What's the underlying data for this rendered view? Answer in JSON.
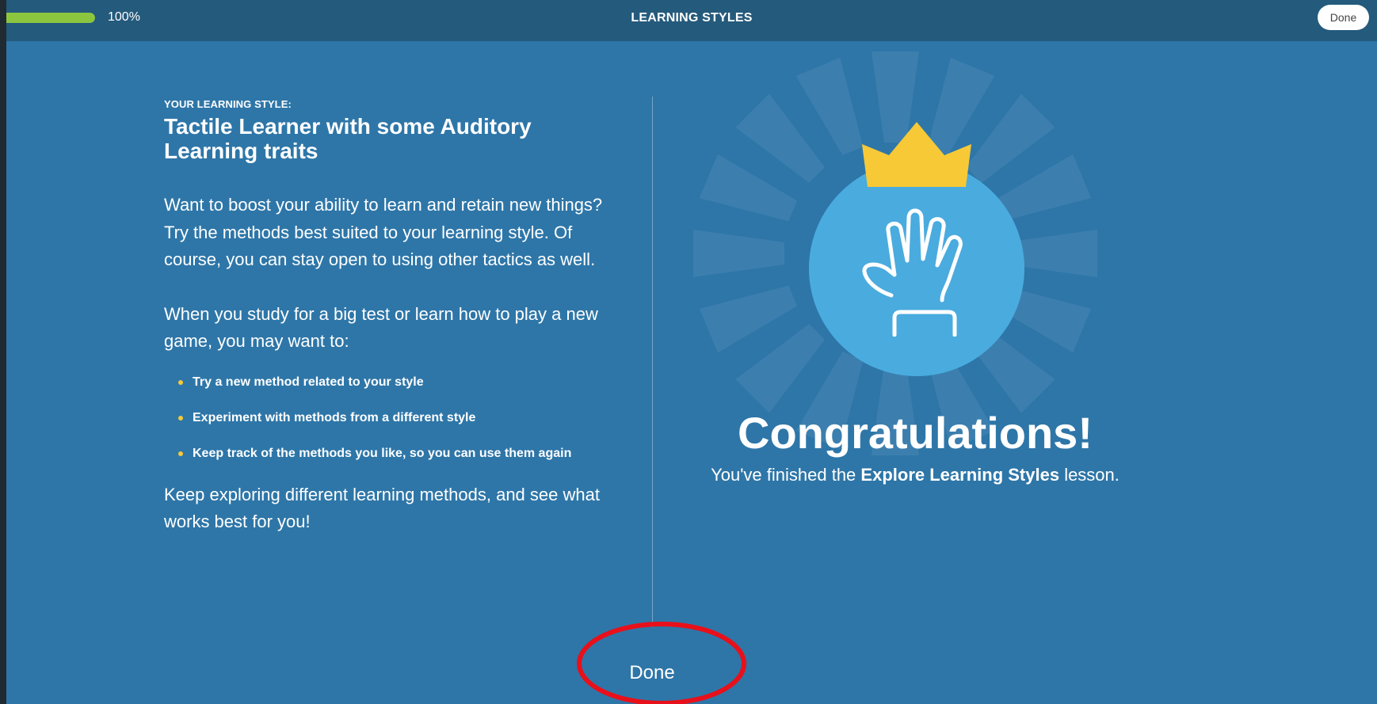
{
  "header": {
    "progress_percent": 100,
    "progress_label": "100%",
    "title": "LEARNING STYLES",
    "done_label": "Done"
  },
  "content": {
    "eyebrow": "YOUR LEARNING STYLE:",
    "headline_line1": "Tactile Learner with some Auditory",
    "headline_line2": "Learning traits",
    "paragraph1": "Want to boost your ability to learn and retain new things? Try the methods best suited to your learning style. Of course, you can stay open to using other tactics as well.",
    "paragraph2": "When you study for a big test or learn how to play a new game, you may want to:",
    "bullets": [
      "Try a new method related to your style",
      "Experiment with methods from a different style",
      "Keep track of the methods you like, so you can use them again"
    ],
    "paragraph3": "Keep exploring different learning methods, and see what works best for you!"
  },
  "result": {
    "congrats": "Congratulations!",
    "sub_before": "You've finished the",
    "sub_bold": "Explore Learning Styles",
    "sub_after": "lesson.",
    "badge_icon": "hand-icon",
    "crown_icon": "crown-icon"
  },
  "footer": {
    "done_label": "Done"
  },
  "colors": {
    "background": "#2e76a8",
    "topbar": "#245a7c",
    "progress": "#8cc63f",
    "badge": "#4aabdf",
    "crown": "#f7c936",
    "annotation": "#e8101a"
  }
}
